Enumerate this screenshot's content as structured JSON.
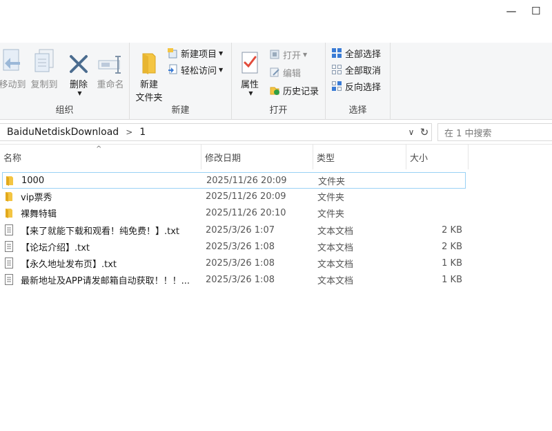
{
  "window": {
    "minimize_glyph": "—",
    "maximize_glyph": "☐"
  },
  "ribbon": {
    "organize": {
      "label": "组织",
      "move_to": "移动到",
      "copy_to": "复制到",
      "delete": "删除",
      "rename": "重命名"
    },
    "new": {
      "label": "新建",
      "new_folder": "新建\n文件夹",
      "new_folder_line1": "新建",
      "new_folder_line2": "文件夹",
      "new_item": "新建项目",
      "easy_access": "轻松访问"
    },
    "open": {
      "label": "打开",
      "properties": "属性",
      "open": "打开",
      "edit": "编辑",
      "history": "历史记录"
    },
    "select": {
      "label": "选择",
      "select_all": "全部选择",
      "select_none": "全部取消",
      "invert": "反向选择"
    }
  },
  "address": {
    "crumbs": [
      "BaiduNetdiskDownload",
      "1"
    ],
    "separator": ">",
    "dropdown_glyph": "∨",
    "refresh_glyph": "↻"
  },
  "search": {
    "placeholder": "在 1 中搜索"
  },
  "columns": {
    "name": "名称",
    "date": "修改日期",
    "type": "类型",
    "size": "大小",
    "sort_glyph": "^"
  },
  "files": [
    {
      "name": "1000",
      "date": "2025/11/26 20:09",
      "type": "文件夹",
      "size": "",
      "icon": "folder-icon",
      "selected": true
    },
    {
      "name": "vip票秀",
      "date": "2025/11/26 20:09",
      "type": "文件夹",
      "size": "",
      "icon": "folder-icon",
      "selected": false
    },
    {
      "name": "裸舞特辑",
      "date": "2025/11/26 20:10",
      "type": "文件夹",
      "size": "",
      "icon": "folder-icon",
      "selected": false
    },
    {
      "name": "【来了就能下载和观看！纯免费！】.txt",
      "date": "2025/3/26 1:07",
      "type": "文本文档",
      "size": "2 KB",
      "icon": "text-file-icon",
      "selected": false
    },
    {
      "name": "【论坛介绍】.txt",
      "date": "2025/3/26 1:08",
      "type": "文本文档",
      "size": "2 KB",
      "icon": "text-file-icon",
      "selected": false
    },
    {
      "name": "【永久地址发布页】.txt",
      "date": "2025/3/26 1:08",
      "type": "文本文档",
      "size": "1 KB",
      "icon": "text-file-icon",
      "selected": false
    },
    {
      "name": "最新地址及APP请发邮箱自动获取！！！...",
      "date": "2025/3/26 1:08",
      "type": "文本文档",
      "size": "1 KB",
      "icon": "text-file-icon",
      "selected": false
    }
  ],
  "colors": {
    "accent": "#1a73c8",
    "folder": "#f2c94c",
    "selection_border": "#99d1f5"
  }
}
